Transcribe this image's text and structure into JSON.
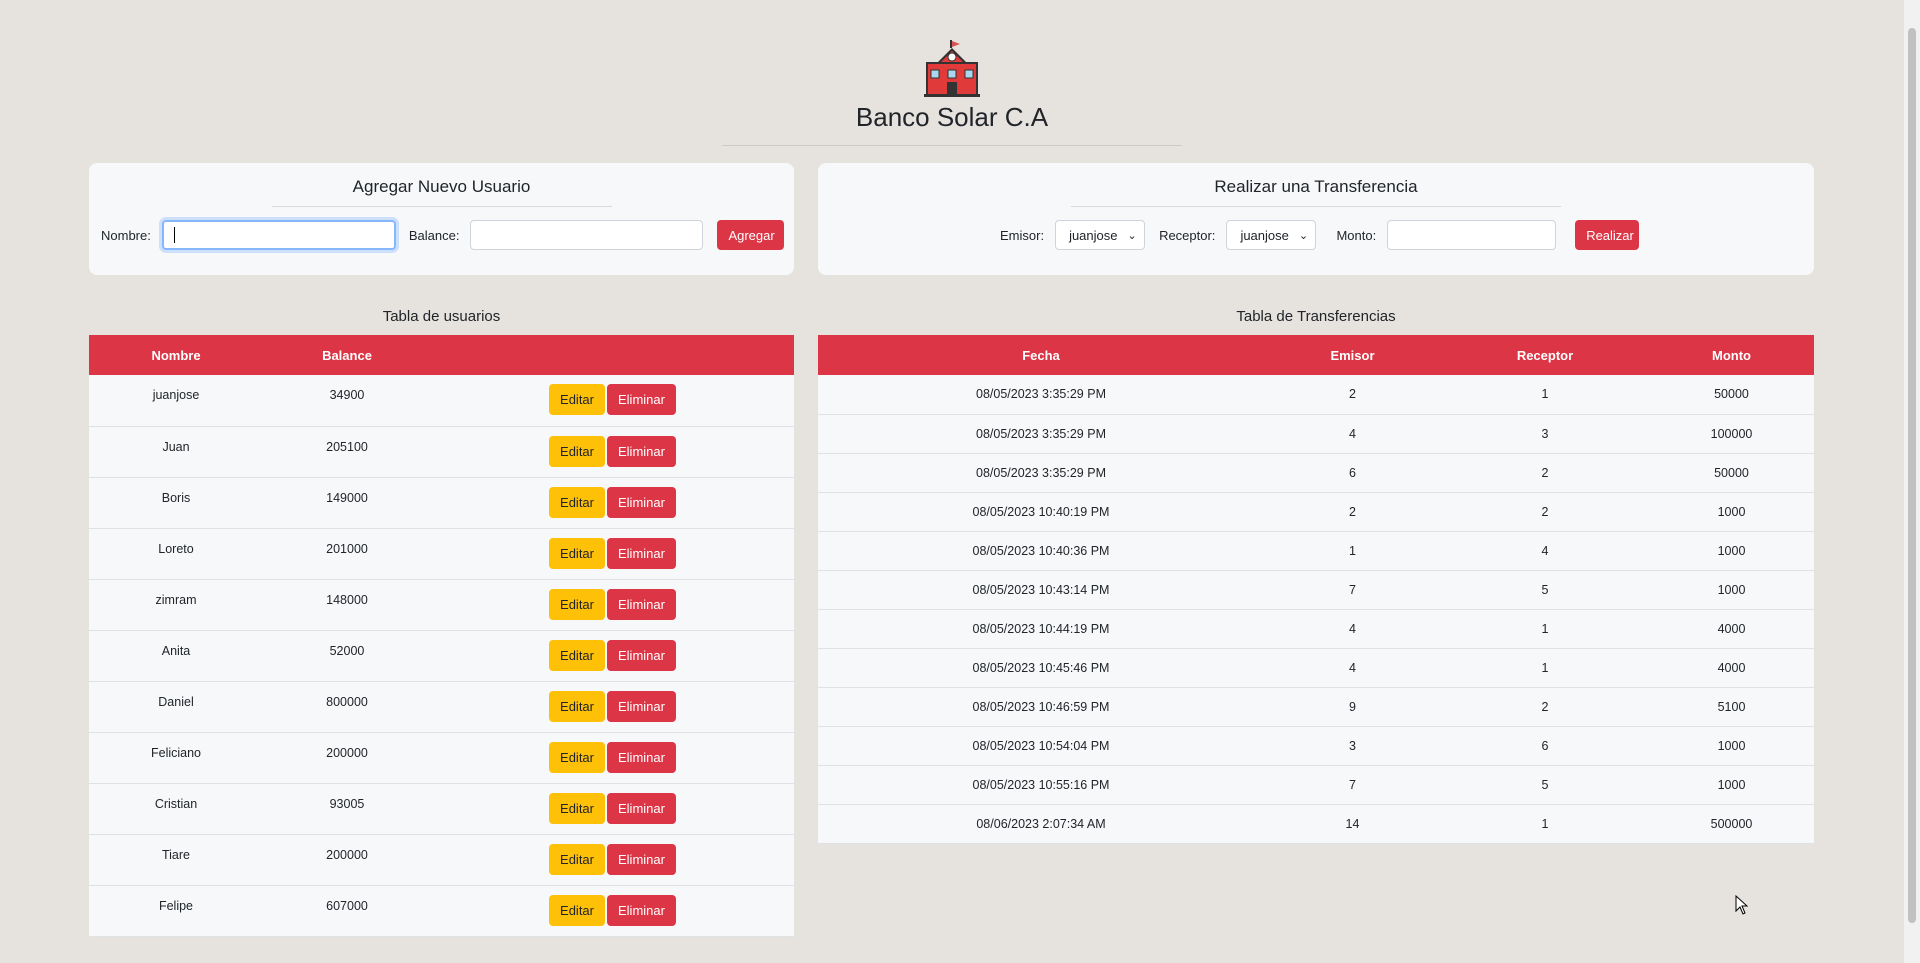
{
  "header": {
    "title": "Banco Solar C.A",
    "logo_icon": "school-building-icon"
  },
  "add_user": {
    "title": "Agregar Nuevo Usuario",
    "name_label": "Nombre:",
    "name_value": "",
    "balance_label": "Balance:",
    "balance_value": "",
    "submit_label": "Agregar"
  },
  "transfer": {
    "title": "Realizar una Transferencia",
    "sender_label": "Emisor:",
    "sender_selected": "juanjose",
    "receiver_label": "Receptor:",
    "receiver_selected": "juanjose",
    "amount_label": "Monto:",
    "amount_value": "",
    "submit_label": "Realizar"
  },
  "users_table": {
    "title": "Tabla de usuarios",
    "headers": [
      "Nombre",
      "Balance"
    ],
    "edit_label": "Editar",
    "delete_label": "Eliminar",
    "rows": [
      {
        "name": "juanjose",
        "balance": "34900"
      },
      {
        "name": "Juan",
        "balance": "205100"
      },
      {
        "name": "Boris",
        "balance": "149000"
      },
      {
        "name": "Loreto",
        "balance": "201000"
      },
      {
        "name": "zimram",
        "balance": "148000"
      },
      {
        "name": "Anita",
        "balance": "52000"
      },
      {
        "name": "Daniel",
        "balance": "800000"
      },
      {
        "name": "Feliciano",
        "balance": "200000"
      },
      {
        "name": "Cristian",
        "balance": "93005"
      },
      {
        "name": "Tiare",
        "balance": "200000"
      },
      {
        "name": "Felipe",
        "balance": "607000"
      }
    ]
  },
  "transfers_table": {
    "title": "Tabla de Transferencias",
    "headers": [
      "Fecha",
      "Emisor",
      "Receptor",
      "Monto"
    ],
    "rows": [
      {
        "date": "08/05/2023 3:35:29 PM",
        "sender": "2",
        "receiver": "1",
        "amount": "50000"
      },
      {
        "date": "08/05/2023 3:35:29 PM",
        "sender": "4",
        "receiver": "3",
        "amount": "100000"
      },
      {
        "date": "08/05/2023 3:35:29 PM",
        "sender": "6",
        "receiver": "2",
        "amount": "50000"
      },
      {
        "date": "08/05/2023 10:40:19 PM",
        "sender": "2",
        "receiver": "2",
        "amount": "1000"
      },
      {
        "date": "08/05/2023 10:40:36 PM",
        "sender": "1",
        "receiver": "4",
        "amount": "1000"
      },
      {
        "date": "08/05/2023 10:43:14 PM",
        "sender": "7",
        "receiver": "5",
        "amount": "1000"
      },
      {
        "date": "08/05/2023 10:44:19 PM",
        "sender": "4",
        "receiver": "1",
        "amount": "4000"
      },
      {
        "date": "08/05/2023 10:45:46 PM",
        "sender": "4",
        "receiver": "1",
        "amount": "4000"
      },
      {
        "date": "08/05/2023 10:46:59 PM",
        "sender": "9",
        "receiver": "2",
        "amount": "5100"
      },
      {
        "date": "08/05/2023 10:54:04 PM",
        "sender": "3",
        "receiver": "6",
        "amount": "1000"
      },
      {
        "date": "08/05/2023 10:55:16 PM",
        "sender": "7",
        "receiver": "5",
        "amount": "1000"
      },
      {
        "date": "08/06/2023 2:07:34 AM",
        "sender": "14",
        "receiver": "1",
        "amount": "500000"
      }
    ]
  },
  "colors": {
    "primary_red": "#dc3545",
    "warning_yellow": "#ffc107",
    "background": "#e6e3df"
  }
}
